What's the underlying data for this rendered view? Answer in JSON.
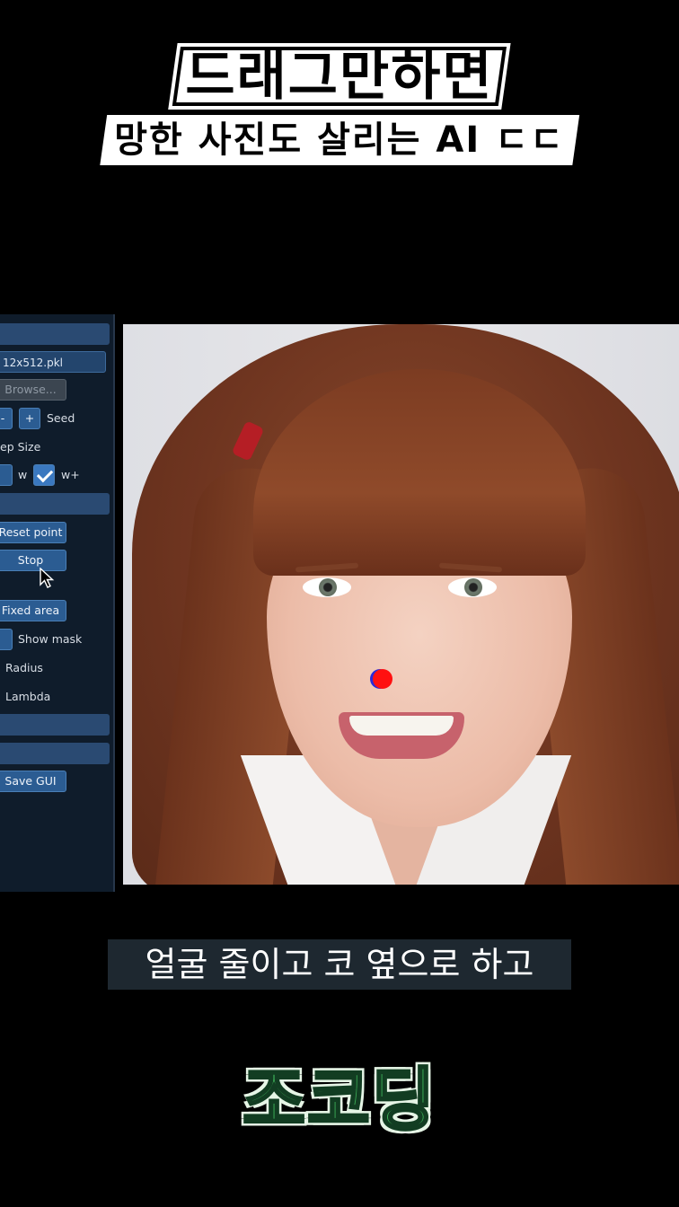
{
  "title": {
    "line1": "드래그만하면",
    "line2": "망한 사진도 살리는 AI ㄷㄷ"
  },
  "gui_panel": {
    "model_file": "12x512.pkl",
    "browse_label": "Browse...",
    "minus_label": "-",
    "plus_label": "+",
    "seed_label": "Seed",
    "step_size_label": "ep Size",
    "w_label": "w",
    "w_plus_label": "w+",
    "w_plus_checked": true,
    "reset_point_label": "Reset point",
    "stop_label": "Stop",
    "fixed_area_label": "Fixed area",
    "show_mask_label": "Show mask",
    "radius_label": "Radius",
    "lambda_label": "Lambda",
    "save_gui_label": "Save GUI"
  },
  "canvas": {
    "description_icon": "portrait-photo"
  },
  "subtitle": {
    "text": "얼굴 줄이고 코 옆으로 하고"
  },
  "brand": {
    "logo_text": "조코딩"
  },
  "colors": {
    "background": "#000000",
    "panel_bg": "#0f1c2b",
    "button_blue": "#2b5c92",
    "handle_point": "#ff1010",
    "logo_green": "#3fb35a"
  }
}
